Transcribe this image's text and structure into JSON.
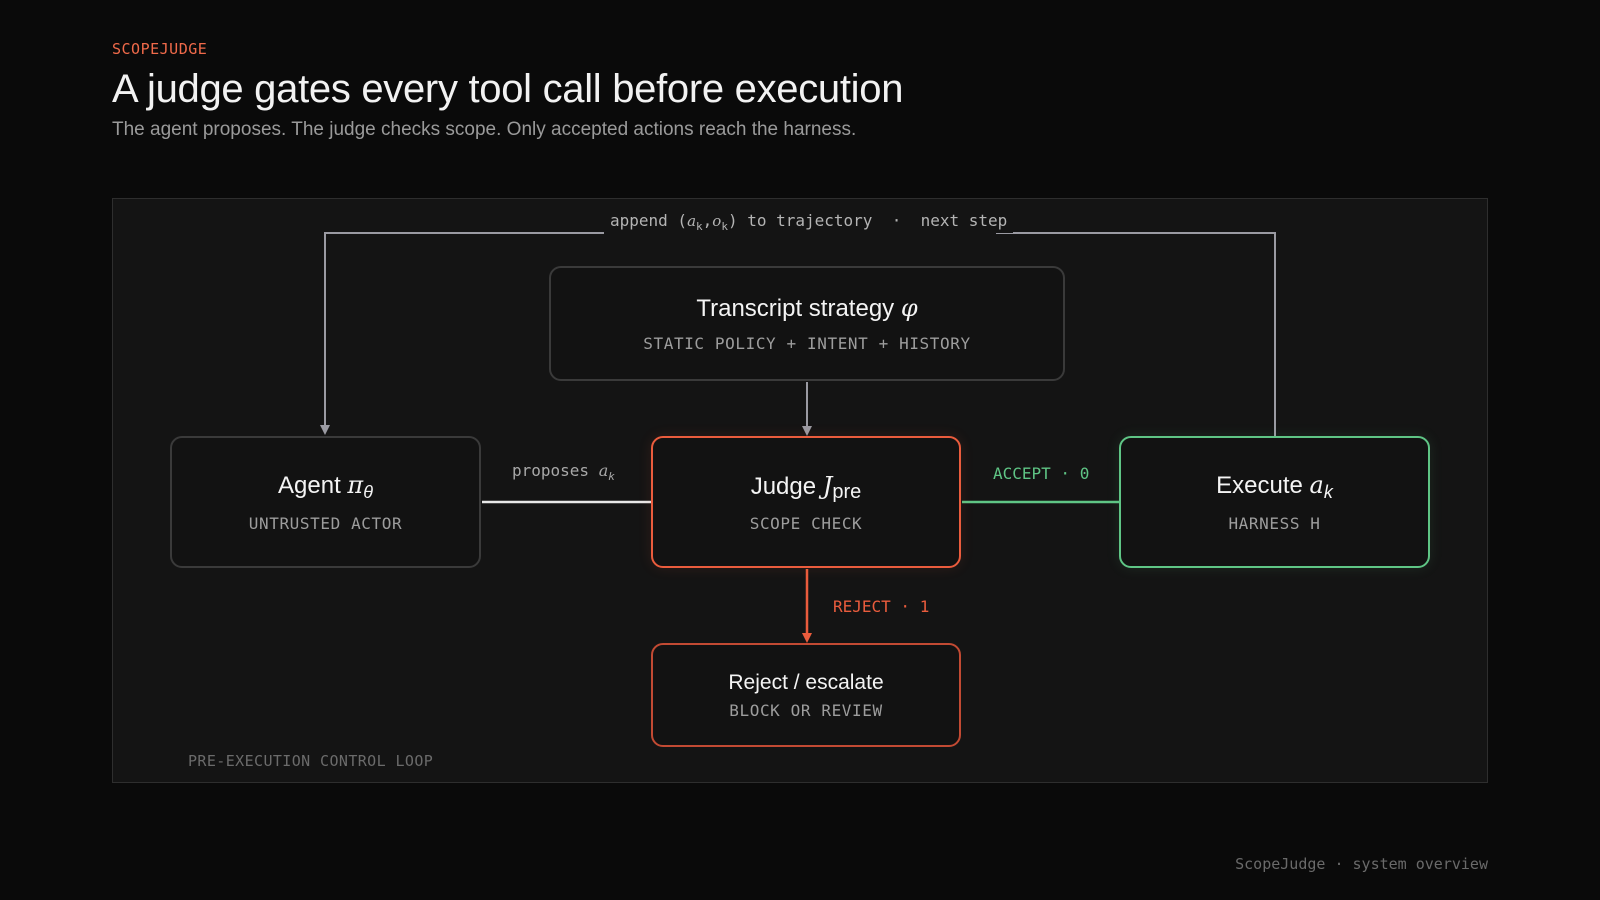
{
  "header": {
    "eyebrow": "SCOPEJUDGE",
    "title": "A judge gates every tool call before execution",
    "subtitle": "The agent proposes. The judge checks scope. Only accepted actions reach the harness."
  },
  "diagram": {
    "panel_label": "PRE-EXECUTION CONTROL LOOP",
    "loop_label": {
      "prefix": "append (",
      "a": "a",
      "a_sub": "k",
      "comma": ",",
      "o": "o",
      "o_sub": "k",
      "suffix": ") to trajectory  ·  next step"
    },
    "strategy": {
      "title": "Transcript strategy ",
      "symbol": "φ",
      "subtitle": "STATIC POLICY + INTENT + HISTORY"
    },
    "agent": {
      "title": "Agent ",
      "symbol": "π",
      "symbol_sub": "θ",
      "subtitle": "UNTRUSTED ACTOR"
    },
    "judge": {
      "title": "Judge ",
      "symbol": "J",
      "symbol_sub": "pre",
      "subtitle": "SCOPE CHECK"
    },
    "execute": {
      "title": "Execute ",
      "symbol": "a",
      "symbol_sub": "k",
      "subtitle": "HARNESS H"
    },
    "reject": {
      "title": "Reject / escalate",
      "subtitle": "BLOCK OR REVIEW"
    },
    "edges": {
      "proposes": {
        "text": "proposes ",
        "symbol": "a",
        "symbol_sub": "k"
      },
      "accept": "ACCEPT · 0",
      "reject": "REJECT · 1"
    }
  },
  "footer": {
    "text": "ScopeJudge · system overview"
  },
  "colors": {
    "background": "#0a0a0a",
    "panel": "#141414",
    "accent_red": "#ea5c3d",
    "accent_green": "#5fc585",
    "wire_gray": "#9a9aa2"
  }
}
